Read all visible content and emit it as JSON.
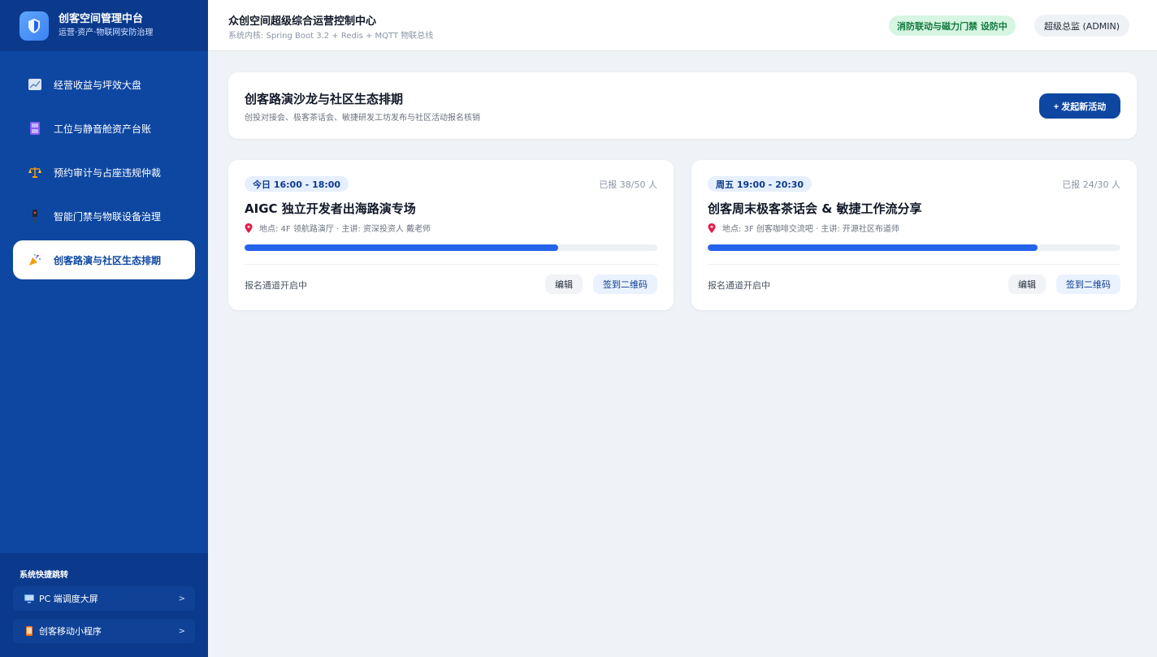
{
  "brand": {
    "title": "创客空间管理中台",
    "subtitle": "运营·资产·物联网安防治理"
  },
  "sidebar": {
    "items": [
      {
        "label": "经营收益与坪效大盘",
        "icon": "chart-icon"
      },
      {
        "label": "工位与静音舱资产台账",
        "icon": "booth-icon"
      },
      {
        "label": "预约审计与占座违规仲裁",
        "icon": "scales-icon"
      },
      {
        "label": "智能门禁与物联设备治理",
        "icon": "device-icon"
      },
      {
        "label": "创客路演与社区生态排期",
        "icon": "party-popper-icon",
        "active": true
      }
    ]
  },
  "quick": {
    "title": "系统快捷跳转",
    "items": [
      {
        "label": "PC 端调度大屏",
        "icon": "monitor-icon"
      },
      {
        "label": "创客移动小程序",
        "icon": "phone-icon"
      }
    ]
  },
  "header": {
    "title": "众创空间超级综合运营控制中心",
    "subtitle": "系统内核: Spring Boot 3.2 + Redis + MQTT 物联总线",
    "alert_badge": "消防联动与磁力门禁 设防中",
    "user": "超级总监 (ADMIN)"
  },
  "panel": {
    "title": "创客路演沙龙与社区生态排期",
    "subtitle": "创投对接会、极客茶话会、敏捷研发工坊发布与社区活动报名核销",
    "new_button": "+ 发起新活动"
  },
  "events": [
    {
      "time": "今日 16:00 - 18:00",
      "count": "已报 38/50 人",
      "title": "AIGC 独立开发者出海路演专场",
      "meta": "地点: 4F 领航路演厅 · 主讲: 资深投资人 戴老师",
      "progress": 0.76,
      "status": "报名通道开启中",
      "edit": "编辑",
      "qr": "签到二维码"
    },
    {
      "time": "周五 19:00 - 20:30",
      "count": "已报 24/30 人",
      "title": "创客周末极客茶话会 & 敏捷工作流分享",
      "meta": "地点: 3F 创客咖啡交流吧 · 主讲: 开源社区布道师",
      "progress": 0.8,
      "status": "报名通道开启中",
      "edit": "编辑",
      "qr": "签到二维码"
    }
  ],
  "colors": {
    "sidebar": "#0e47a1",
    "accent": "#2563eb",
    "badge_bg": "#d7f5e3",
    "badge_text": "#117a3e"
  }
}
